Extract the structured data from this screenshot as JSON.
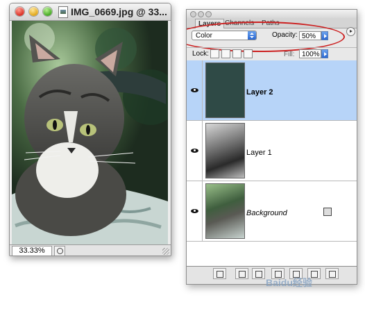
{
  "document_window": {
    "title": "IMG_0669.jpg @ 33...",
    "zoom": "33.33%",
    "image_description_icon": "cat-photo"
  },
  "layers_palette": {
    "tabs": [
      {
        "label": "Layers",
        "active": true
      },
      {
        "label": "Channels",
        "active": false
      },
      {
        "label": "Paths",
        "active": false
      }
    ],
    "blend_mode": "Color",
    "opacity_label": "Opacity:",
    "opacity_value": "50%",
    "lock_label": "Lock:",
    "fill_label": "Fill:",
    "fill_value": "100%",
    "layers": [
      {
        "name": "Layer 2",
        "selected": true,
        "visible": true,
        "thumb_color": "#2f4a46"
      },
      {
        "name": "Layer 1",
        "selected": false,
        "visible": true
      },
      {
        "name": "Background",
        "selected": false,
        "visible": true,
        "locked": true
      }
    ],
    "bottom_buttons": [
      "link-icon",
      "add-style-icon",
      "add-mask-icon",
      "adjustment-layer-icon",
      "new-group-icon",
      "new-layer-icon",
      "trash-icon"
    ]
  },
  "colors": {
    "selection": "#b7d4f8",
    "annotation": "#cc2020",
    "accent": "#2a67d0"
  },
  "watermark": "Baidu经验"
}
